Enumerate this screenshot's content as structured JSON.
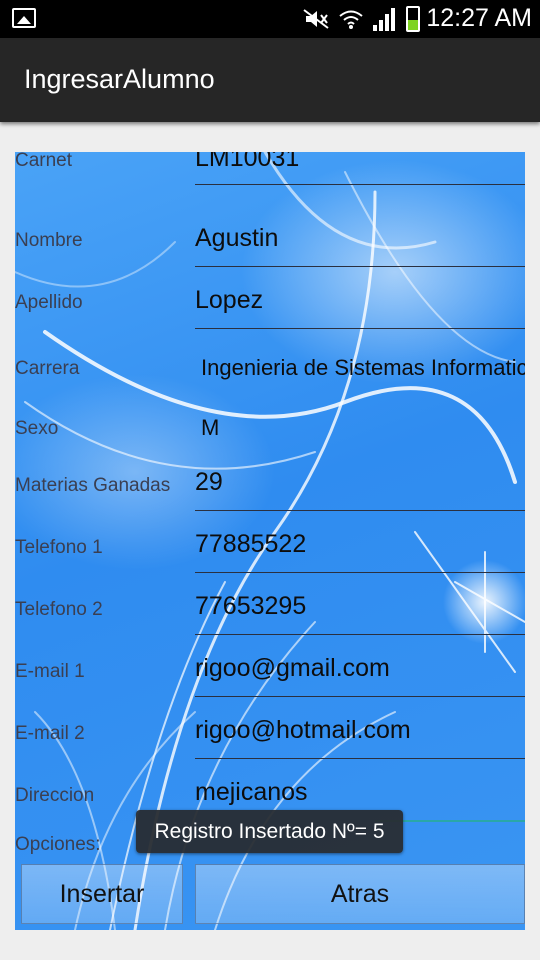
{
  "status_bar": {
    "time": "12:27 AM"
  },
  "app": {
    "title": "IngresarAlumno"
  },
  "form": {
    "fields": [
      {
        "label": "Carnet",
        "value": "LM10031"
      },
      {
        "label": "Nombre",
        "value": "Agustin"
      },
      {
        "label": "Apellido",
        "value": "Lopez"
      },
      {
        "label": "Carrera",
        "value": "Ingenieria de Sistemas Informaticos"
      },
      {
        "label": "Sexo",
        "value": "M"
      },
      {
        "label": "Materias Ganadas",
        "value": "29"
      },
      {
        "label": "Telefono 1",
        "value": "77885522"
      },
      {
        "label": "Telefono 2",
        "value": "77653295"
      },
      {
        "label": "E-mail 1",
        "value": "rigoo@gmail.com"
      },
      {
        "label": "E-mail 2",
        "value": "rigoo@hotmail.com"
      },
      {
        "label": "Direccion",
        "value": "mejicanos"
      }
    ],
    "options_label": "Opciones:"
  },
  "buttons": {
    "insert": "Insertar",
    "back": "Atras"
  },
  "toast": {
    "message": "Registro Insertado Nº= 5"
  },
  "colors": {
    "panel_blue": "#3a95f3",
    "action_bar": "#262626",
    "toast_bg": "#282c32"
  }
}
